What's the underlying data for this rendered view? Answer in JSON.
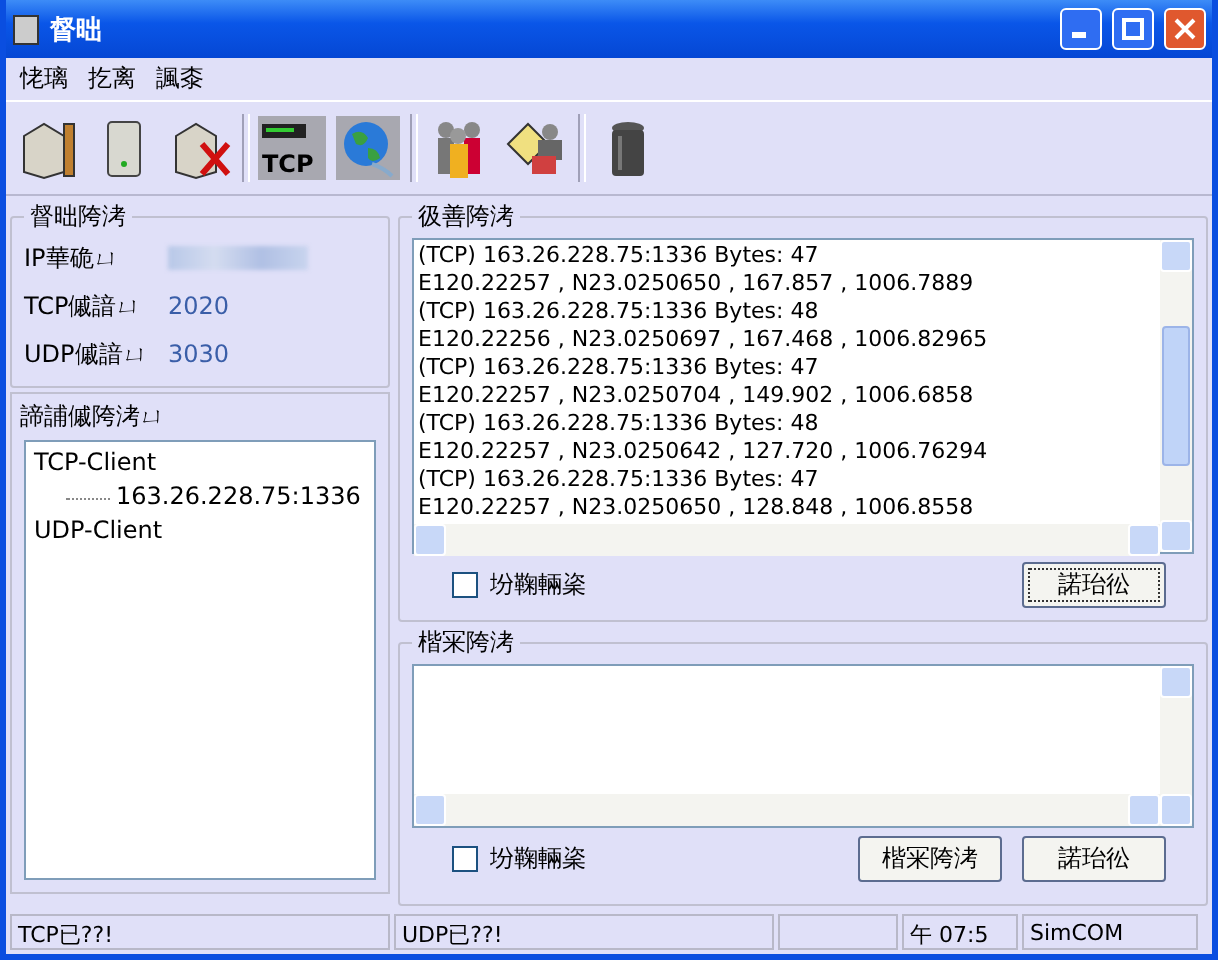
{
  "window": {
    "title": "督昢"
  },
  "menu": [
    "恅璃",
    "扢离",
    "諷桼"
  ],
  "toolbar": [
    {
      "kind": "server-door"
    },
    {
      "kind": "server"
    },
    {
      "kind": "server-cross"
    },
    {
      "kind": "tcp",
      "label": "TCP"
    },
    {
      "kind": "globe"
    },
    {
      "kind": "people"
    },
    {
      "kind": "card-person"
    },
    {
      "kind": "trash"
    }
  ],
  "server_info": {
    "title": "督昢陓洘",
    "fields": [
      {
        "label": "IP華硊ㄩ",
        "kind": "blurred"
      },
      {
        "label": "TCP傶諳ㄩ",
        "value": "2020",
        "kind": "text"
      },
      {
        "label": "UDP傶諳ㄩ",
        "value": "3030",
        "kind": "text"
      }
    ]
  },
  "clients": {
    "title": "諦誧傶陓洘ㄩ",
    "tree": [
      {
        "label": "TCP-Client",
        "children": [
          {
            "label": "163.26.228.75:1336"
          }
        ]
      },
      {
        "label": "UDP-Client"
      }
    ]
  },
  "received": {
    "title": "彶善陓洘",
    "lines": [
      "(TCP) 163.26.228.75:1336 Bytes: 47",
      "E120.22257 , N23.0250650 , 167.857 , 1006.7889",
      "(TCP) 163.26.228.75:1336 Bytes: 48",
      "E120.22256 , N23.0250697 , 167.468 , 1006.82965",
      "(TCP) 163.26.228.75:1336 Bytes: 47",
      "E120.22257 , N23.0250704 , 149.902 , 1006.6858",
      "(TCP) 163.26.228.75:1336 Bytes: 48",
      "E120.22257 , N23.0250642 , 127.720 , 1006.76294",
      "(TCP) 163.26.228.75:1336 Bytes: 47",
      "E120.22257 , N23.0250650 , 128.848 , 1006.8558"
    ],
    "hex": {
      "label": "坋鞠輛秶",
      "checked": false
    },
    "buttons": [
      "諾珆彸"
    ]
  },
  "send": {
    "title": "楷冞陓洘",
    "hex": {
      "label": "坋鞠輛秶",
      "checked": false
    },
    "buttons": [
      "楷冞陓洘",
      "諾珆彸"
    ]
  },
  "status_bar": [
    {
      "kind": "text",
      "text": "TCP已??!"
    },
    {
      "kind": "text",
      "text": "UDP已??!"
    },
    {
      "kind": "blank"
    },
    {
      "kind": "text",
      "text": "午 07:5"
    },
    {
      "kind": "text",
      "text": "SimCOM"
    }
  ]
}
